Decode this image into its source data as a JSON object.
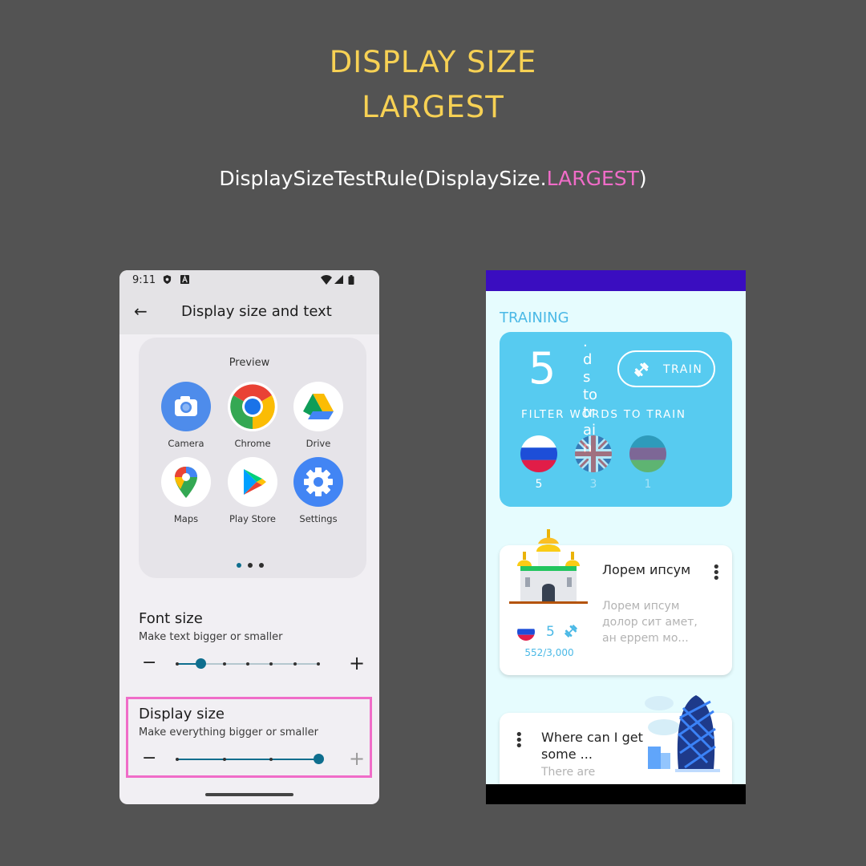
{
  "header": {
    "title_line1": "DISPLAY SIZE",
    "title_line2": "LARGEST",
    "code_prefix": "DisplaySizeTestRule(DisplaySize.",
    "code_highlight": "LARGEST",
    "code_suffix": ")",
    "title_color": "#F7D154",
    "highlight_color": "#F06CC8"
  },
  "settings_phone": {
    "status_time": "9:11",
    "status_icons": [
      "shield-icon",
      "a-icon",
      "wifi-icon",
      "signal-icon",
      "battery-icon"
    ],
    "title": "Display size and text",
    "back_icon": "back-arrow-icon",
    "preview_label": "Preview",
    "apps": [
      {
        "label": "Camera",
        "icon": "camera-icon"
      },
      {
        "label": "Chrome",
        "icon": "chrome-icon"
      },
      {
        "label": "Drive",
        "icon": "drive-icon"
      },
      {
        "label": "Maps",
        "icon": "maps-icon"
      },
      {
        "label": "Play Store",
        "icon": "play-store-icon"
      },
      {
        "label": "Settings",
        "icon": "settings-icon"
      }
    ],
    "page_dots": 3,
    "active_dot": 0,
    "font_size": {
      "title": "Font size",
      "subtitle": "Make text bigger or smaller",
      "minus": "−",
      "plus": "+",
      "steps": 7,
      "value_index": 1
    },
    "display_size": {
      "title": "Display size",
      "subtitle": "Make everything bigger or smaller",
      "minus": "−",
      "plus": "+",
      "steps": 4,
      "value_index": 3
    },
    "accent_color": "#0E6E8E"
  },
  "app_phone": {
    "section_label": "TRAINING",
    "train_card": {
      "count": "5",
      "vertical_text": ". d s to tr ai n",
      "train_button": "TRAIN",
      "filter_label": "FILTER WORDS TO TRAIN",
      "flags": [
        {
          "name": "russia-flag-icon",
          "count": "5"
        },
        {
          "name": "uk-flag-icon",
          "count": "3"
        },
        {
          "name": "unknown-flag-icon",
          "count": "1"
        }
      ]
    },
    "lesson_card": {
      "title": "Лорем ипсум",
      "description": "Лорем ипсум долор сит амет, ан ерреm мо...",
      "count": "5",
      "progress": "552/3,000"
    },
    "lesson_card2": {
      "title": "Where can I get some ...",
      "description": "There are"
    },
    "status_bar_color": "#3A0DC0",
    "card_color": "#57CBF0"
  }
}
